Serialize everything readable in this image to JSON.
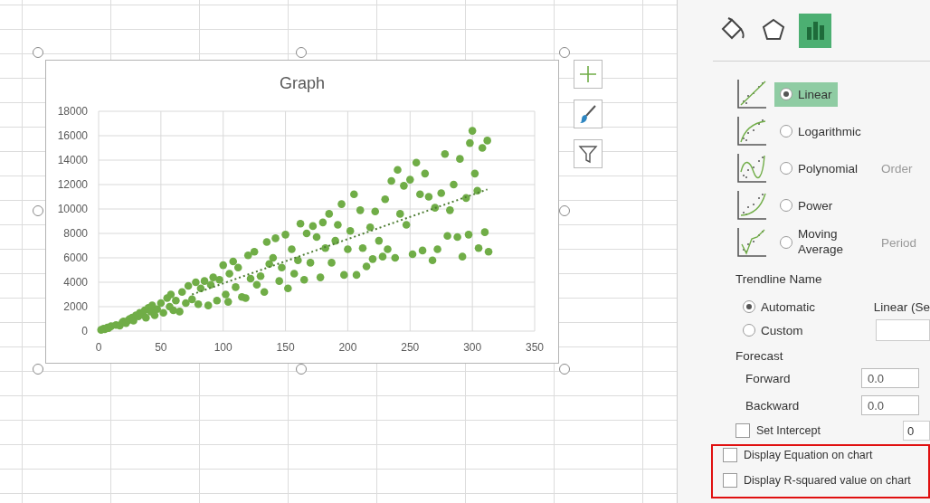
{
  "chart": {
    "chart_data": {
      "type": "scatter",
      "title": "Graph",
      "x": [
        2,
        4,
        5,
        7,
        8,
        10,
        14,
        17,
        19,
        20,
        22,
        24,
        25,
        27,
        28,
        30,
        32,
        33,
        35,
        37,
        38,
        40,
        42,
        43,
        45,
        47,
        50,
        52,
        55,
        57,
        58,
        60,
        62,
        65,
        67,
        70,
        72,
        75,
        78,
        80,
        82,
        85,
        88,
        90,
        92,
        95,
        97,
        100,
        102,
        104,
        105,
        108,
        110,
        112,
        115,
        118,
        120,
        122,
        125,
        127,
        130,
        133,
        135,
        137,
        140,
        142,
        145,
        147,
        150,
        152,
        155,
        157,
        160,
        162,
        165,
        167,
        170,
        172,
        175,
        178,
        180,
        182,
        185,
        187,
        190,
        192,
        195,
        197,
        200,
        202,
        205,
        207,
        210,
        212,
        215,
        218,
        220,
        222,
        225,
        228,
        230,
        232,
        235,
        238,
        240,
        242,
        245,
        247,
        250,
        252,
        255,
        258,
        260,
        262,
        265,
        268,
        270,
        272,
        275,
        278,
        280,
        282,
        285,
        288,
        290,
        292,
        295,
        297,
        298,
        300,
        302,
        304,
        305,
        308,
        310,
        312,
        313
      ],
      "series": [
        {
          "color": "#70ad47",
          "values": [
            100,
            200,
            150,
            300,
            250,
            400,
            500,
            450,
            700,
            800,
            650,
            900,
            1000,
            1100,
            850,
            1300,
            1200,
            1500,
            1400,
            1700,
            1100,
            1900,
            1600,
            2100,
            1300,
            1800,
            2300,
            1500,
            2700,
            2000,
            3000,
            1700,
            2500,
            1600,
            3200,
            2300,
            3700,
            2600,
            4000,
            2200,
            3500,
            4100,
            2100,
            3800,
            4400,
            2500,
            4200,
            5400,
            3000,
            2400,
            4700,
            5700,
            3600,
            5200,
            2800,
            2700,
            6200,
            4300,
            6500,
            3800,
            4500,
            3200,
            7300,
            5500,
            6000,
            7600,
            4100,
            5200,
            7900,
            3500,
            6700,
            4700,
            5800,
            8800,
            4200,
            8000,
            5600,
            8600,
            7700,
            4400,
            8900,
            6800,
            9600,
            5600,
            7400,
            8700,
            10400,
            4600,
            6700,
            8200,
            11200,
            4600,
            9900,
            6800,
            5300,
            8500,
            5900,
            9800,
            7400,
            6100,
            10800,
            6700,
            12300,
            6000,
            13200,
            9600,
            11900,
            8700,
            12400,
            6300,
            13800,
            11200,
            6600,
            12900,
            11000,
            5800,
            10100,
            6700,
            11300,
            14500,
            7800,
            9900,
            12000,
            7700,
            14100,
            6100,
            10900,
            7900,
            15400,
            16400,
            12900,
            11500,
            6800,
            15000,
            8100,
            15600,
            6500
          ]
        },
        {
          "type": "line",
          "line_style": "dotted",
          "color": "#4e7d34",
          "values": [
            null,
            null,
            null,
            null,
            null,
            null,
            null,
            null,
            null,
            null,
            null,
            null,
            null,
            null,
            null,
            null,
            null,
            null,
            null,
            null,
            null,
            null,
            null,
            null,
            null,
            null,
            null,
            null,
            null,
            null,
            null,
            null,
            null,
            null,
            null,
            null,
            null,
            3000,
            null,
            null,
            null,
            null,
            null,
            null,
            null,
            null,
            null,
            null,
            null,
            null,
            null,
            null,
            null,
            null,
            null,
            null,
            null,
            null,
            null,
            null,
            null,
            null,
            null,
            null,
            null,
            null,
            null,
            null,
            null,
            null,
            null,
            null,
            null,
            null,
            null,
            null,
            null,
            null,
            null,
            null,
            null,
            null,
            null,
            null,
            null,
            null,
            null,
            null,
            null,
            null,
            null,
            null,
            null,
            null,
            null,
            null,
            null,
            null,
            null,
            null,
            null,
            null,
            null,
            null,
            null,
            null,
            null,
            null,
            null,
            null,
            null,
            null,
            null,
            null,
            null,
            null,
            null,
            null,
            null,
            null,
            null,
            null,
            null,
            null,
            null,
            null,
            null,
            null,
            null,
            null,
            null,
            null,
            null,
            null,
            null,
            11600,
            null
          ]
        }
      ],
      "xlim": [
        0,
        350
      ],
      "ylim": [
        0,
        18000
      ],
      "xticks": [
        0,
        50,
        100,
        150,
        200,
        250,
        300,
        350
      ],
      "yticks": [
        0,
        2000,
        4000,
        6000,
        8000,
        10000,
        12000,
        14000,
        16000,
        18000
      ],
      "grid": true
    }
  },
  "chart_buttons": [
    {
      "kind": "plus"
    },
    {
      "kind": "brush"
    },
    {
      "kind": "filter"
    }
  ],
  "pane": {
    "tabs": [
      {
        "kind": "fill",
        "selected": false
      },
      {
        "kind": "effects",
        "selected": false
      },
      {
        "kind": "options",
        "selected": true
      }
    ],
    "trend_types": [
      {
        "kind": "linear",
        "label": "Linear",
        "selected": true
      },
      {
        "kind": "logarithmic",
        "label": "Logarithmic",
        "selected": false
      },
      {
        "kind": "polynomial",
        "label": "Polynomial",
        "selected": false,
        "param": "Order"
      },
      {
        "kind": "power",
        "label": "Power",
        "selected": false
      },
      {
        "kind": "moving",
        "label": "Moving Average",
        "selected": false,
        "param": "Period"
      }
    ],
    "trendline_name": {
      "label": "Trendline Name",
      "options": [
        {
          "label": "Automatic",
          "selected": true,
          "value": "Linear (Se"
        },
        {
          "label": "Custom",
          "selected": false
        }
      ]
    },
    "forecast": {
      "label": "Forecast",
      "fields": [
        {
          "label": "Forward",
          "value": "0.0"
        },
        {
          "label": "Backward",
          "value": "0.0"
        }
      ]
    },
    "checkboxes": [
      {
        "label": "Set Intercept",
        "checked": false,
        "value": "0"
      },
      {
        "label": "Display Equation on chart",
        "checked": false
      },
      {
        "label": "Display R-squared value on chart",
        "checked": false
      }
    ]
  }
}
